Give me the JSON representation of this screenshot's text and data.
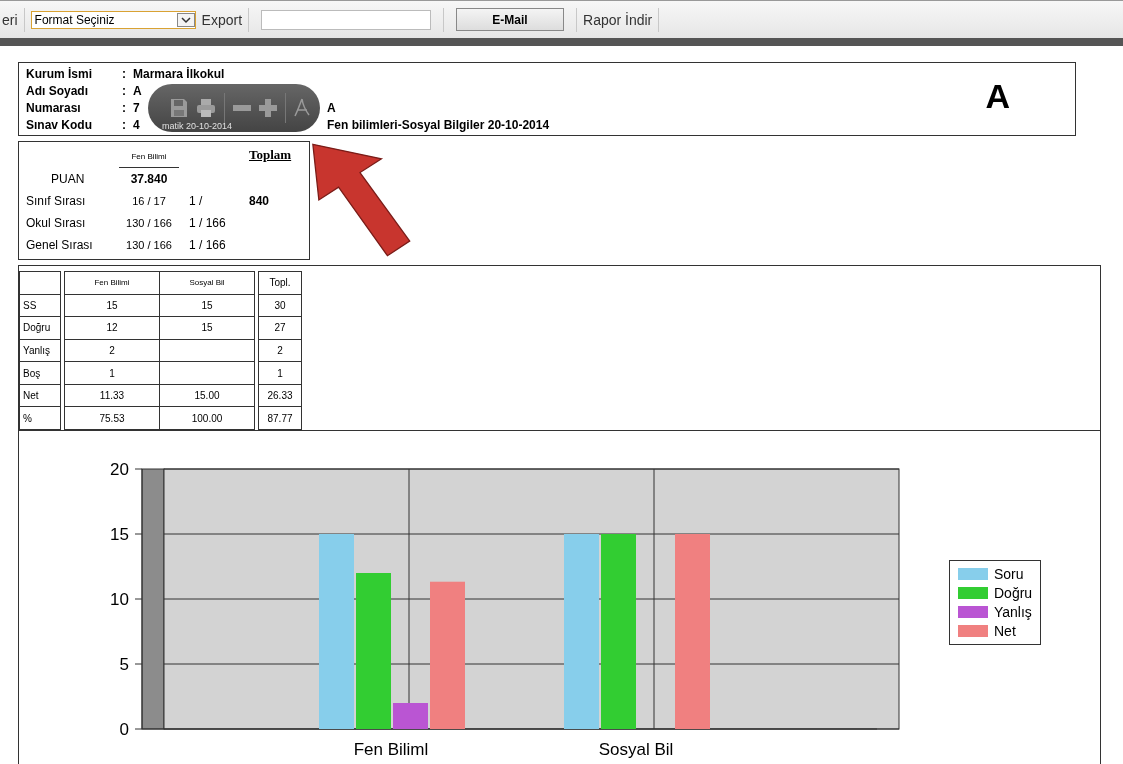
{
  "toolbar": {
    "cut_label": "eri",
    "format_select": {
      "value": "Format Seçiniz"
    },
    "export_label": "Export",
    "email_button": "E-Mail",
    "download_label": "Rapor İndir"
  },
  "header": {
    "fields": [
      {
        "label": "Kurum İsmi",
        "colon": ":",
        "value": "Marmara İlkokul"
      },
      {
        "label": "Adı Soyadı",
        "colon": ":",
        "value": "A"
      },
      {
        "label": "Numarası",
        "colon": ":",
        "value": "7",
        "tail": "A"
      },
      {
        "label": "Sınav Kodu",
        "colon": ":",
        "value": "4",
        "tail": "Fen bilimleri-Sosyal Bilgiler 20-10-2014"
      }
    ],
    "grade": "A"
  },
  "viewer_toolbar": {
    "caption": "matik 20-10-2014"
  },
  "puan_table": {
    "subject": "Fen Bilimi",
    "total_heading": "Toplam",
    "total_value": "840",
    "rows": [
      {
        "label": "PUAN",
        "fen": "37.840",
        "other": ""
      },
      {
        "label": "Sınıf Sırası",
        "fen": "16 / 17",
        "other": "1 /"
      },
      {
        "label": "Okul Sırası",
        "fen": "130 / 166",
        "other": "1 / 166"
      },
      {
        "label": "Genel Sırası",
        "fen": "130 / 166",
        "other": "1 / 166"
      }
    ]
  },
  "score_table": {
    "columns": [
      "Fen Bilimi",
      "Sosyal Bil"
    ],
    "total_heading": "Topl.",
    "rows": [
      {
        "label": "SS",
        "fen": "15",
        "sosyal": "15",
        "total": "30"
      },
      {
        "label": "Doğru",
        "fen": "12",
        "sosyal": "15",
        "total": "27"
      },
      {
        "label": "Yanlış",
        "fen": "2",
        "total": "2"
      },
      {
        "label": "Boş",
        "fen": "1",
        "total": "1"
      },
      {
        "label": "Net",
        "fen": "11.33",
        "sosyal": "15.00",
        "total": "26.33"
      },
      {
        "label": "%",
        "fen": "75.53",
        "sosyal": "100.00",
        "total": "87.77"
      }
    ]
  },
  "chart_data": {
    "type": "bar",
    "categories": [
      "Fen Biliml",
      "Sosyal Bil"
    ],
    "ylim": [
      0,
      20
    ],
    "yticks": [
      0,
      5,
      10,
      15,
      20
    ],
    "grid": true,
    "series": [
      {
        "name": "Soru",
        "color": "#87ceeb",
        "values": [
          15,
          15
        ]
      },
      {
        "name": "Doğru",
        "color": "#32cd32",
        "values": [
          12,
          15
        ]
      },
      {
        "name": "Yanlış",
        "color": "#ba55d3",
        "values": [
          2,
          null
        ]
      },
      {
        "name": "Net",
        "color": "#f08080",
        "values": [
          11.33,
          15
        ]
      }
    ]
  }
}
